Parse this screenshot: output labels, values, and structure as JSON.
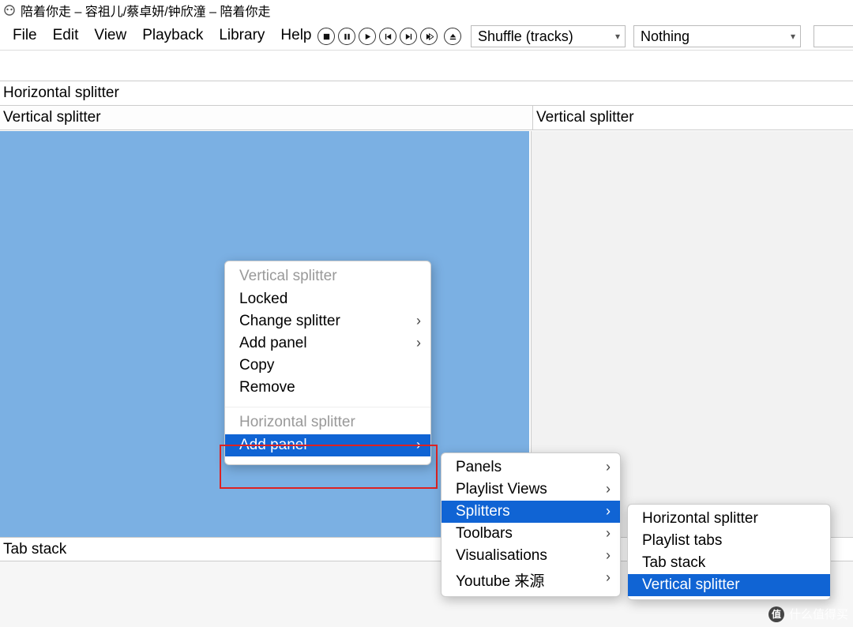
{
  "title": "陪着你走 – 容祖儿/蔡卓妍/钟欣潼 – 陪着你走",
  "menubar": [
    "File",
    "Edit",
    "View",
    "Playback",
    "Library",
    "Help"
  ],
  "order_combo": "Shuffle (tracks)",
  "repeat_combo": "Nothing",
  "headers": {
    "hsplit": "Horizontal splitter",
    "vsplit_left": "Vertical splitter",
    "vsplit_right": "Vertical splitter",
    "tabstack": "Tab stack"
  },
  "ctx1": {
    "group1_title": "Vertical splitter",
    "items1": [
      {
        "label": "Locked",
        "sub": false
      },
      {
        "label": "Change splitter",
        "sub": true
      },
      {
        "label": "Add panel",
        "sub": true
      },
      {
        "label": "Copy",
        "sub": false
      },
      {
        "label": "Remove",
        "sub": false
      }
    ],
    "group2_title": "Horizontal splitter",
    "items2": [
      {
        "label": "Add panel",
        "sub": true,
        "hl": true
      }
    ]
  },
  "ctx2": {
    "items": [
      {
        "label": "Panels",
        "sub": true
      },
      {
        "label": "Playlist Views",
        "sub": true
      },
      {
        "label": "Splitters",
        "sub": true,
        "hl": true
      },
      {
        "label": "Toolbars",
        "sub": true
      },
      {
        "label": "Visualisations",
        "sub": true
      },
      {
        "label": "Youtube 来源",
        "sub": true
      }
    ]
  },
  "ctx3": {
    "items": [
      {
        "label": "Horizontal splitter"
      },
      {
        "label": "Playlist tabs"
      },
      {
        "label": "Tab stack"
      },
      {
        "label": "Vertical splitter",
        "hl": true
      }
    ]
  },
  "watermark": "什么值得买"
}
